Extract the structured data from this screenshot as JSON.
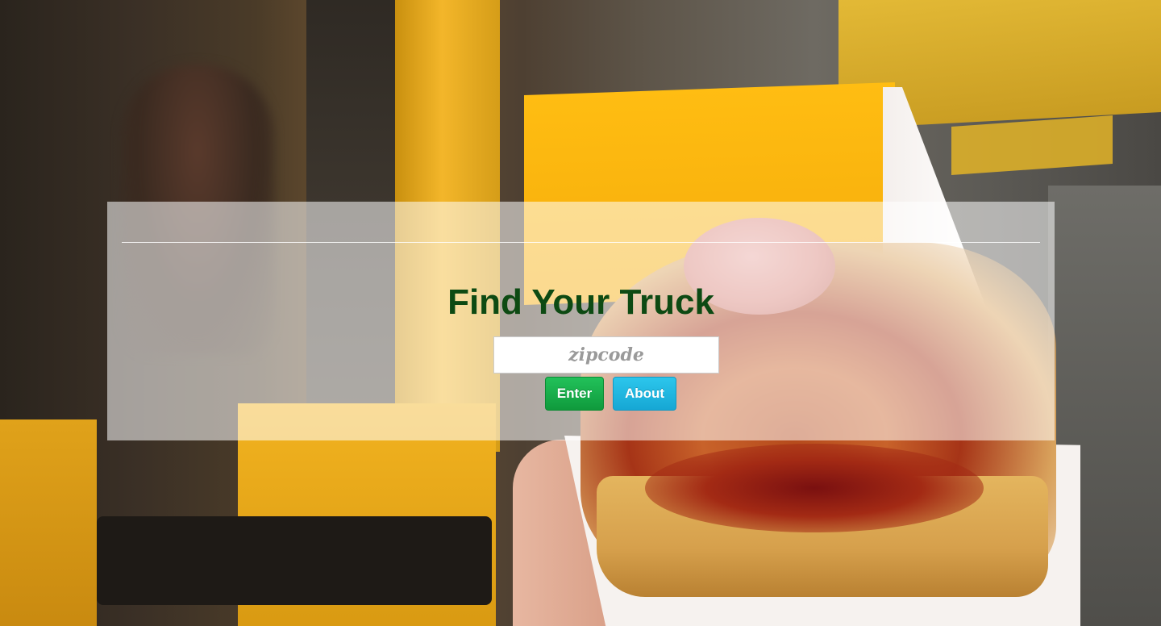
{
  "hero": {
    "title": "Find Your Truck",
    "search": {
      "placeholder": "zipcode",
      "value": ""
    },
    "buttons": {
      "enter_label": "Enter",
      "about_label": "About"
    }
  },
  "colors": {
    "title": "#0d4a13",
    "enter_button": "#12a848",
    "about_button": "#1fb6e0",
    "overlay": "rgba(255,255,255,0.55)"
  }
}
